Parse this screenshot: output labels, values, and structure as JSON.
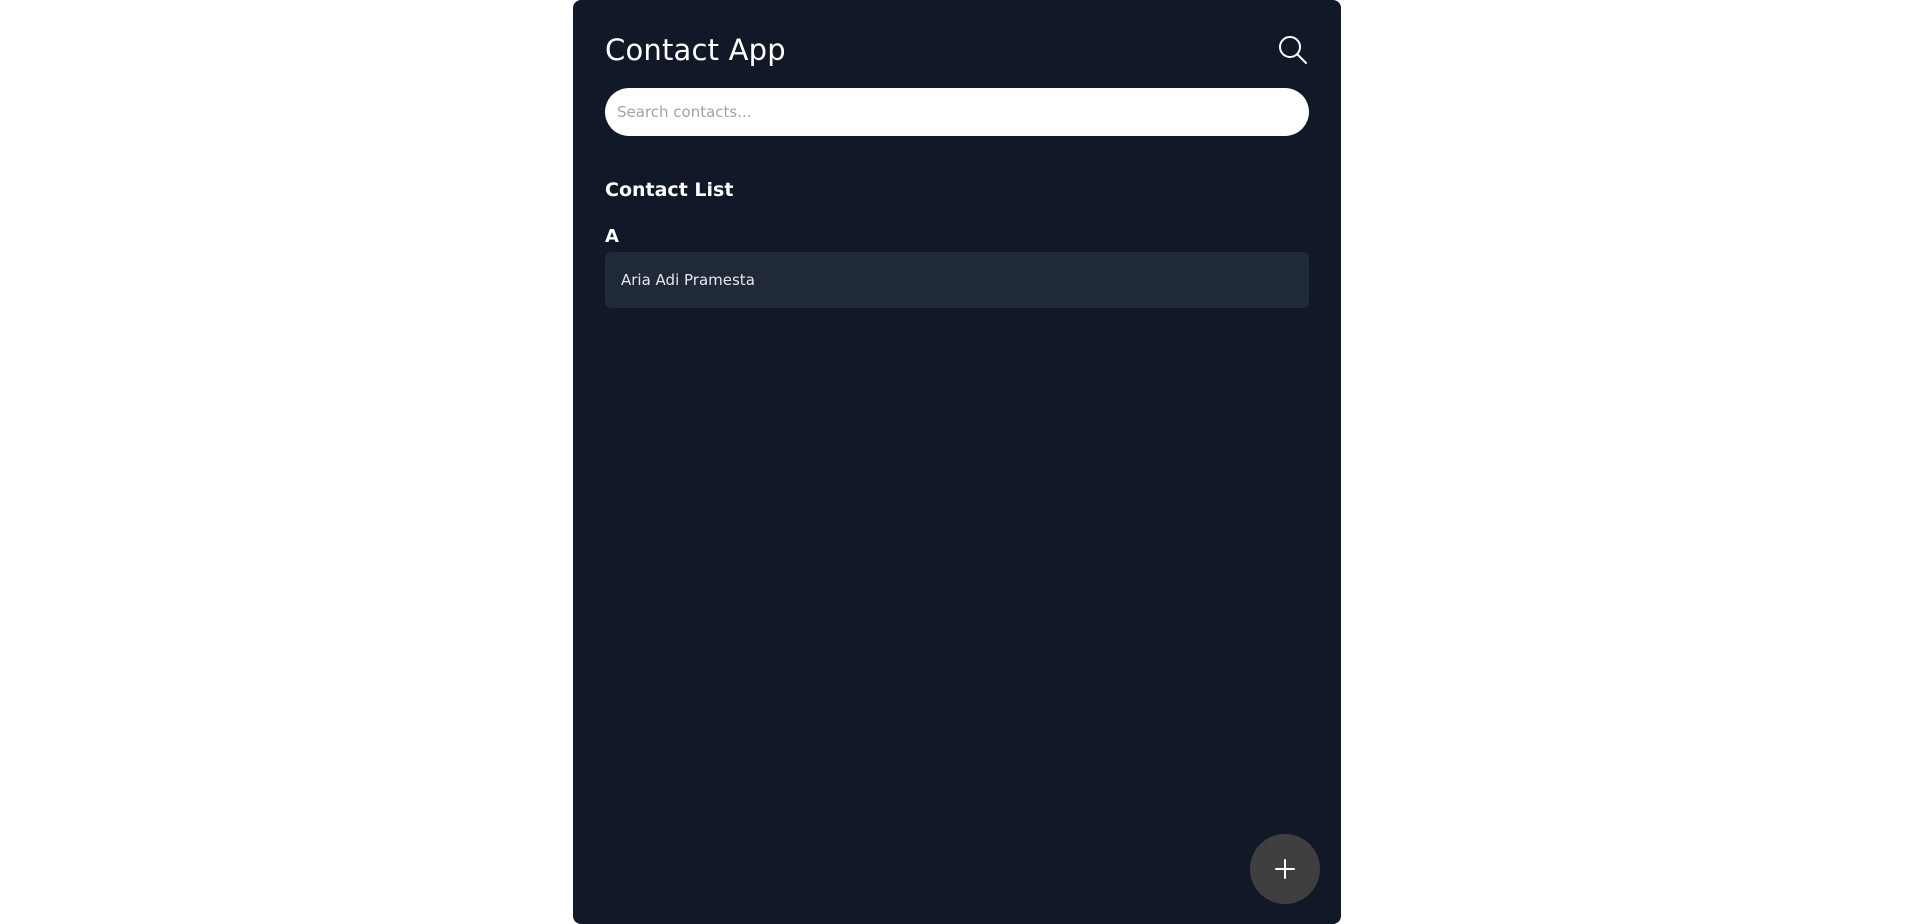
{
  "header": {
    "title": "Contact App",
    "search_icon": "search-icon"
  },
  "search": {
    "placeholder": "Search contacts...",
    "value": ""
  },
  "contact_list": {
    "title": "Contact List",
    "groups": [
      {
        "letter": "A",
        "contacts": [
          {
            "name": "Aria Adi Pramesta"
          }
        ]
      }
    ]
  },
  "fab": {
    "icon": "plus-icon"
  },
  "colors": {
    "app_background": "#111827",
    "contact_item_background": "#1f2937",
    "fab_background": "#3f3f3f",
    "text_primary": "#ffffff"
  }
}
